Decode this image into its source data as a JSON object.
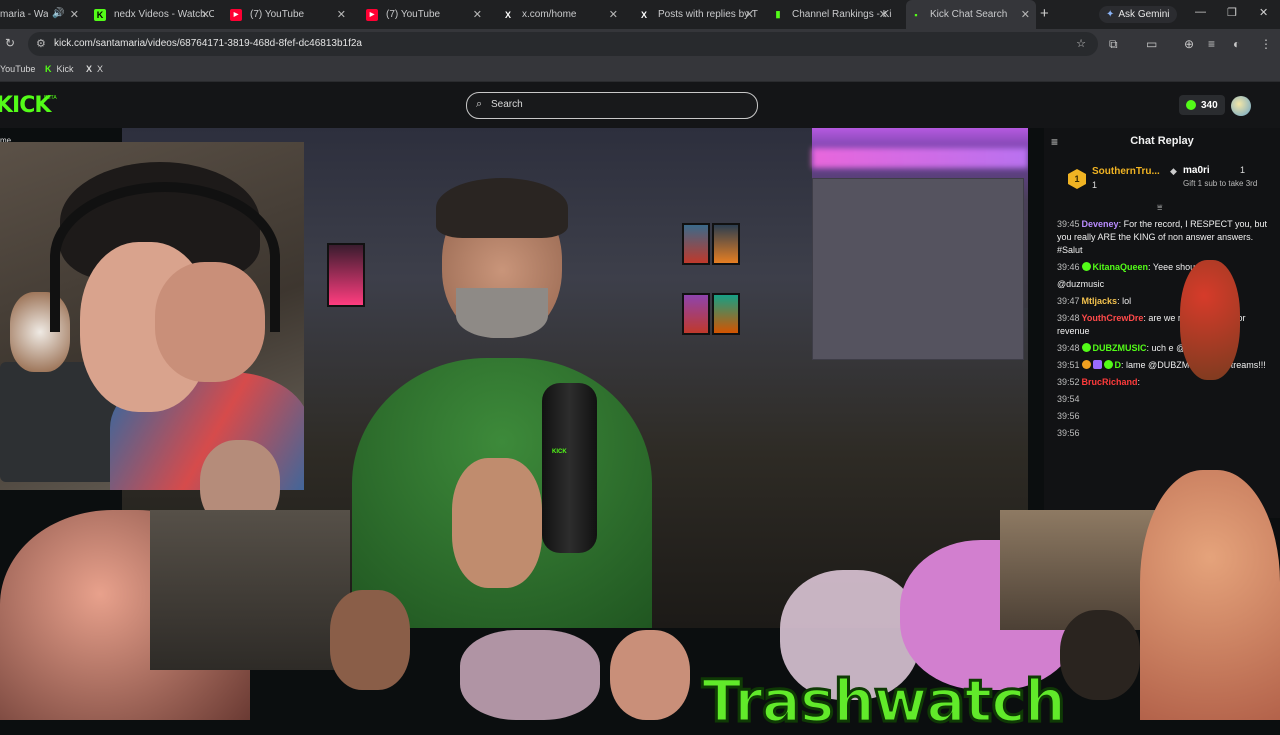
{
  "browser": {
    "tabs": [
      {
        "label": "maria - Watc",
        "favicon": "K",
        "color": "#53fc18"
      },
      {
        "label": "nedx Videos - Watch C",
        "favicon": "K",
        "color": "#53fc18"
      },
      {
        "label": "(7) YouTube",
        "favicon": "▶",
        "color": "#ff0033"
      },
      {
        "label": "(7) YouTube",
        "favicon": "▶",
        "color": "#ff0033"
      },
      {
        "label": "x.com/home",
        "favicon": "X",
        "color": "#ffffff"
      },
      {
        "label": "Posts with replies by Tr",
        "favicon": "X",
        "color": "#ffffff"
      },
      {
        "label": "Channel Rankings - Kic",
        "favicon": "▮",
        "color": "#53fc18"
      },
      {
        "label": "Kick Chat Search",
        "favicon": "▪",
        "color": "#53fc18"
      }
    ],
    "gemini_label": "Ask Gemini",
    "url": "kick.com/santamaria/videos/68764171-3819-468d-8fef-dc46813b1f2a",
    "bookmarks": [
      {
        "label": "YouTube",
        "icon": ""
      },
      {
        "label": "Kick",
        "icon": "K"
      },
      {
        "label": "X",
        "icon": "X"
      }
    ]
  },
  "site": {
    "logo": "KICK",
    "logo_sub": "BETA",
    "search_placeholder": "Search",
    "points": "340",
    "home_label": "me"
  },
  "chat": {
    "title": "Chat Replay",
    "top_gifters": [
      {
        "rank": "1",
        "name": "SouthernTru...",
        "count": "1"
      },
      {
        "name": "ma0ri",
        "count": "1",
        "cta": "Gift 1 sub to take 3rd"
      }
    ],
    "messages": [
      {
        "time": "39:45",
        "user": "Deveney",
        "color": "#b98cff",
        "badges": [],
        "text": "For the record, I RESPECT you, but you really ARE the KING of non answer answers. #Salut"
      },
      {
        "time": "39:46",
        "user": "KitanaQueen",
        "color": "#53fc18",
        "badges": [
          "dot"
        ],
        "text": "Yeee shou"
      },
      {
        "time": "",
        "user": "",
        "color": "#ffffff",
        "badges": [],
        "text": "@duzmusic"
      },
      {
        "time": "39:47",
        "user": "Mtljacks",
        "color": "#f2c14e",
        "badges": [],
        "text": "lol"
      },
      {
        "time": "39:48",
        "user": "YouthCrewDre",
        "color": "#ff4a4a",
        "badges": [],
        "text": "are we r ads too help for revenue"
      },
      {
        "time": "39:48",
        "user": "DUBZMUSIC",
        "color": "#53fc18",
        "badges": [
          "dot"
        ],
        "text": "uch e @s"
      },
      {
        "time": "39:51",
        "user": "D",
        "color": "#53fc18",
        "badges": [
          "gold",
          "sq",
          "dot"
        ],
        "text": "lame @DUBZMUSIC for streams!!!"
      },
      {
        "time": "39:52",
        "user": "BrucRichand",
        "color": "#ff3b3b",
        "badges": [],
        "text": ""
      },
      {
        "time": "39:54",
        "user": "",
        "color": "#ffffff",
        "badges": [],
        "text": ""
      },
      {
        "time": "39:56",
        "user": "",
        "color": "#ffffff",
        "badges": [],
        "text": ""
      },
      {
        "time": "39:56",
        "user": "",
        "color": "#ffffff",
        "badges": [],
        "text": ""
      }
    ]
  },
  "video": {
    "mic_label": "KICK",
    "overlay_text": "Trashwatch"
  },
  "colors": {
    "kick_green": "#53fc18",
    "gold": "#f0b323"
  }
}
